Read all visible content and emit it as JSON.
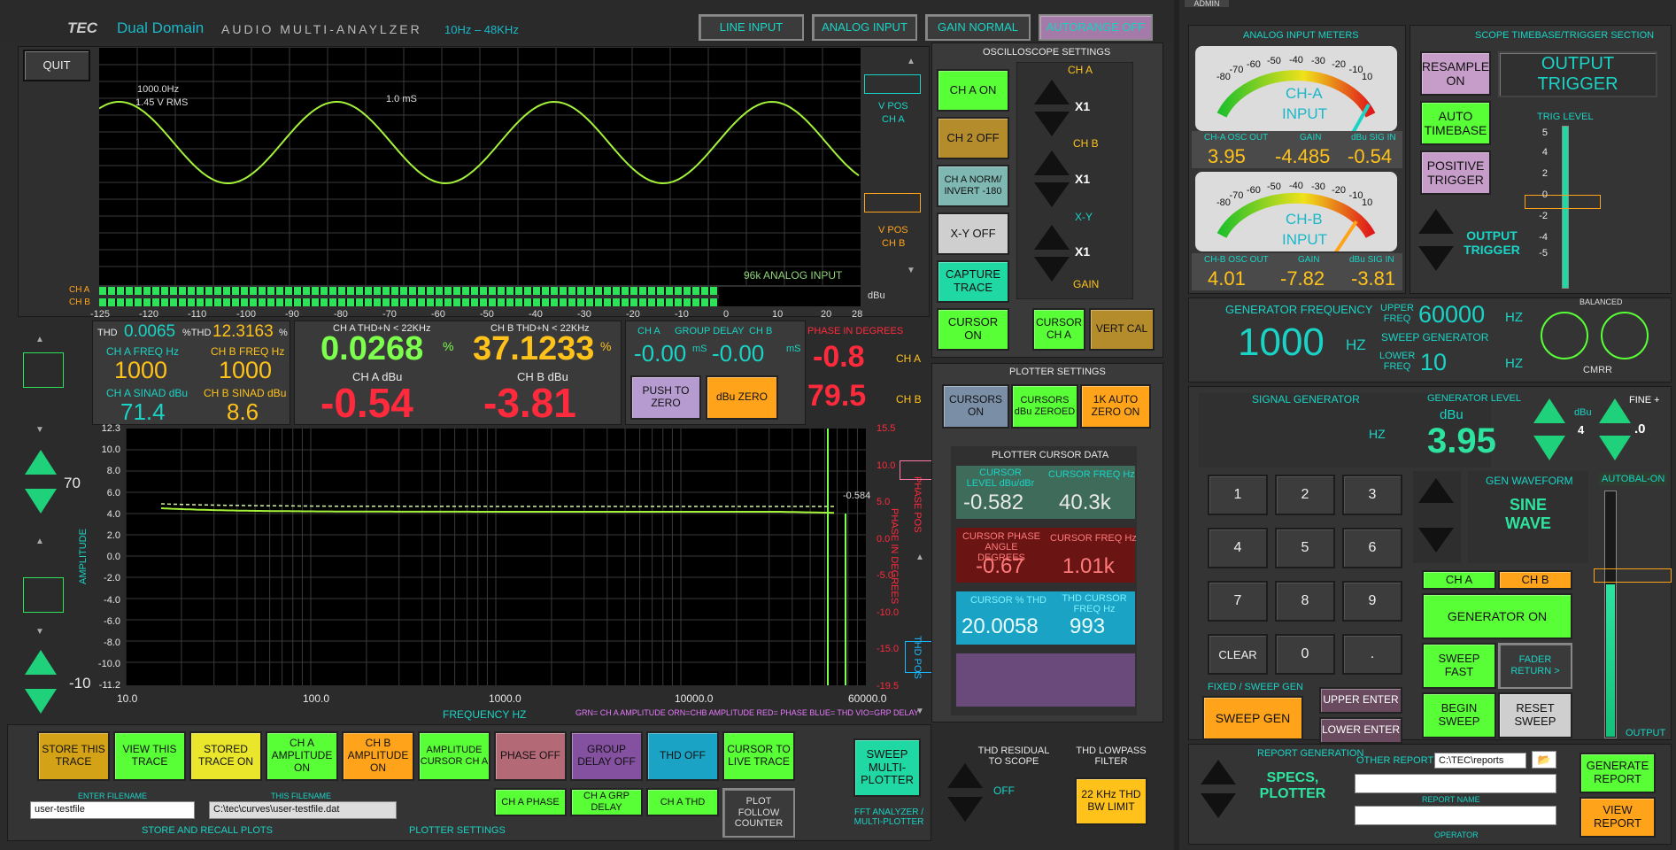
{
  "header": {
    "brand": "TEC",
    "subtitle": "Dual Domain",
    "title": "AUDIO MULTI-ANAYLZER",
    "range": "10Hz – 48KHz",
    "line_input": "LINE INPUT",
    "analog_input": "ANALOG INPUT",
    "gain_normal": "GAIN NORMAL",
    "autorange_off": "AUTORANGE OFF",
    "tab_admin": "ADMIN"
  },
  "quit": "QUIT",
  "scope": {
    "marker1": "1000.0Hz",
    "marker1b": "1.45 V RMS",
    "marker2": "1.0 mS",
    "status": "96k  ANALOG INPUT",
    "vpos_a": "V POS",
    "vpos_a2": "CH A",
    "vpos_b": "V POS",
    "vpos_b2": "CH B",
    "cha": "CH A",
    "chb": "CH B",
    "dbu": "dBu",
    "scale": [
      "-125",
      "-120",
      "-110",
      "-100",
      "-90",
      "-80",
      "-70",
      "-60",
      "-50",
      "-40",
      "-30",
      "-20",
      "-10",
      "0",
      "10",
      "20",
      "28"
    ]
  },
  "readouts": {
    "thd_lbl": "THD",
    "thd_a": "0.0065",
    "pct_thd": "%THD",
    "thd_b": "12.3163",
    "pct": "%",
    "cha_freq_lbl": "CH A FREQ  Hz",
    "chb_freq_lbl": "CH B FREQ  Hz",
    "cha_freq": "1000",
    "chb_freq": "1000",
    "cha_sinad_lbl": "CH A SINAD dBu",
    "chb_sinad_lbl": "CH B SINAD dBu",
    "cha_sinad": "71.4",
    "chb_sinad": "8.6",
    "cha_thdn_lbl": "CH A THD+N  < 22KHz",
    "chb_thdn_lbl": "CH B THD+N  < 22KHz",
    "cha_thdn": "0.0268",
    "chb_thdn": "37.1233",
    "pct1": "%",
    "pct2": "%",
    "cha_dbu_lbl": "CH A dBu",
    "chb_dbu_lbl": "CH B dBu",
    "cha_dbu": "-0.54",
    "chb_dbu": "-3.81",
    "gd_cha": "CH A",
    "gd_lbl": "GROUP DELAY",
    "gd_chb": "CH B",
    "gd_a": "-0.00",
    "gd_b": "-0.00",
    "ms1": "mS",
    "ms2": "mS",
    "push_zero": "PUSH TO ZERO",
    "dbu_zero": "dBu ZERO",
    "phase_lbl": "PHASE IN DEGREES",
    "phase_a": "-0.8",
    "phase_b": "79.5",
    "ph_cha": "CH A",
    "ph_chb": "CH B"
  },
  "left": {
    "val1": "70",
    "val2": "-10"
  },
  "plot": {
    "xlabel": "FREQUENCY HZ",
    "ylabel": "AMPLITUDE",
    "y2label": "PHASE IN DEGREES",
    "phase_pos": "PHASE POS",
    "thd_pos": "THD POS",
    "cursor_val": "-0.584",
    "yticks": [
      "12.3",
      "10.0",
      "8.0",
      "6.0",
      "4.0",
      "2.0",
      "0.0",
      "-2.0",
      "-4.0",
      "-6.0",
      "-8.0",
      "-10.0",
      "-11.2"
    ],
    "y2ticks": [
      "15.5",
      "10.0",
      "5.0",
      "0.0",
      "-5.0",
      "-10.0",
      "-15.0",
      "-19.5"
    ],
    "xticks": [
      "10.0",
      "100.0",
      "1000.0",
      "10000.0",
      "60000.0"
    ],
    "legend": "GRN= CH A AMPLITUDE   ORN=CHB AMPLITUDE   RED= PHASE   BLUE= THD   VIO=GRP DELAY"
  },
  "bottom": {
    "store": "STORE THIS TRACE",
    "view": "VIEW THIS TRACE",
    "stored": "STORED TRACE ON",
    "cha_amp": "CH A AMPLITUDE ON",
    "chb_amp": "CH B AMPLITUDE ON",
    "amp_cursor": "AMPLITUDE CURSOR CH A",
    "phase_off": "PHASE OFF",
    "grp_off": "GROUP DELAY OFF",
    "thd_off": "THD OFF",
    "cursor_live": "CURSOR TO LIVE TRACE",
    "cha_phase": "CH A PHASE",
    "cha_grp": "CH A GRP DELAY",
    "cha_thd": "CH A THD",
    "plot_follow": "PLOT FOLLOW COUNTER",
    "enter_fn": "ENTER FILENAME",
    "this_fn": "THIS FILENAME",
    "filename": "user-testfile",
    "filepath": "C:\\tec\\curves\\user-testfile.dat",
    "store_recall": "STORE AND RECALL PLOTS",
    "plotter_settings": "PLOTTER SETTINGS",
    "sweep_multi": "SWEEP MULTI-PLOTTER",
    "fft": "FFT ANALYZER / MULTI-PLOTTER"
  },
  "osc": {
    "title": "OSCILLOSCOPE SETTINGS",
    "cha_on": "CH A ON",
    "ch2_off": "CH 2 OFF",
    "cha_norm": "CH A NORM/ INVERT -180",
    "xy_off": "X-Y OFF",
    "capture": "CAPTURE TRACE",
    "cursor_on": "CURSOR ON",
    "cursor_cha": "CURSOR CH A",
    "vert_cal": "VERT CAL",
    "cha": "CH A",
    "chb": "CH B",
    "xy": "X-Y",
    "gain": "GAIN",
    "x1a": "X1",
    "x1b": "X1",
    "x1c": "X1"
  },
  "plotter": {
    "title": "PLOTTER SETTINGS",
    "cursors_on": "CURSORS ON",
    "cursors_zeroed": "CURSORS dBu ZEROED",
    "auto_zero": "1K AUTO ZERO ON",
    "cursor_data": "PLOTTER CURSOR DATA",
    "cur_level_lbl": "CURSOR LEVEL dBu/dBr",
    "cur_freq_lbl": "CURSOR FREQ  Hz",
    "cur_level": "-0.582",
    "cur_freq": "40.3k",
    "cur_phase_lbl": "CURSOR PHASE ANGLE DEGREES",
    "cur_freq2_lbl": "CURSOR FREQ  Hz",
    "cur_phase": "-0.67",
    "cur_freq2": "1.01k",
    "cur_thd_lbl": "CURSOR % THD",
    "thd_freq_lbl": "THD CURSOR FREQ  Hz",
    "cur_thd": "20.0058",
    "thd_freq": "993",
    "thd_residual": "THD RESIDUAL TO SCOPE",
    "off": "OFF",
    "thd_lowpass": "THD LOWPASS FILTER",
    "bw_limit": "22 KHz THD BW LIMIT"
  },
  "meters": {
    "title": "ANALOG INPUT METERS",
    "cha": "CH-A",
    "input": "INPUT",
    "chb": "CH-B",
    "input2": "INPUT",
    "scale": [
      "-80",
      "-70",
      "-60",
      "-50",
      "-40",
      "-30",
      "-20",
      "-10",
      "10"
    ],
    "cha_osc_lbl": "CH-A  OSC OUT",
    "gain_lbl": "GAIN",
    "dbu_sig_lbl": "dBu SIG IN",
    "cha_osc": "3.95",
    "cha_gain": "-4.485",
    "cha_sig": "-0.54",
    "chb_osc_lbl": "CH-B OSC  OUT",
    "gain2_lbl": "GAIN",
    "dbu_sig2_lbl": "dBu SIG  IN",
    "chb_osc": "4.01",
    "chb_gain": "-7.82",
    "chb_sig": "-3.81"
  },
  "timebase": {
    "title": "SCOPE TIMEBASE/TRIGGER SECTION",
    "resample": "RESAMPLE ON",
    "auto_tb": "AUTO TIMEBASE",
    "pos_trig": "POSITIVE TRIGGER",
    "output_trig": "OUTPUT TRIGGER",
    "output_trig2": "OUTPUT TRIGGER",
    "trig_level": "TRIG LEVEL",
    "ticks": [
      "5",
      "4",
      "2",
      "0",
      "-2",
      "-4",
      "-5"
    ]
  },
  "genfreq": {
    "title": "GENERATOR FREQUENCY",
    "freq": "1000",
    "hz": "HZ",
    "upper_lbl": "UPPER FREQ",
    "upper": "60000",
    "hz2": "HZ",
    "sweep_gen": "SWEEP GENERATOR",
    "lower_lbl": "LOWER FREQ",
    "lower": "10",
    "hz3": "HZ",
    "balanced": "BALANCED",
    "cmrr": "CMRR"
  },
  "siggen": {
    "title": "SIGNAL GENERATOR",
    "level_lbl": "GENERATOR  LEVEL",
    "dbu": "dBu",
    "hz": "HZ",
    "level": "3.95",
    "fine": "FINE +",
    "dbu2": "dBu",
    "step": "4",
    "step2": ".0",
    "waveform_lbl": "GEN WAVEFORM",
    "waveform": "SINE WAVE",
    "autobal": "AUTOBAL-ON",
    "output": "OUTPUT",
    "keys": [
      "1",
      "2",
      "3",
      "4",
      "5",
      "6",
      "7",
      "8",
      "9",
      "CLEAR",
      "0",
      "."
    ],
    "cha": "CH A",
    "chb": "CH B",
    "gen_on": "GENERATOR ON",
    "sweep_fast": "SWEEP FAST",
    "fader": "FADER RETURN >",
    "begin_sweep": "BEGIN SWEEP",
    "reset_sweep": "RESET SWEEP",
    "fixed_sweep": "FIXED / SWEEP GEN",
    "sweep_gen": "SWEEP GEN",
    "upper_enter": "UPPER ENTER",
    "lower_enter": "LOWER ENTER"
  },
  "report": {
    "title": "REPORT GENERATION",
    "specs": "SPECS, PLOTTER",
    "other": "OTHER REPORTS",
    "path": "C:\\TEC\\reports",
    "report_name": "REPORT NAME",
    "operator": "OPERATOR",
    "generate": "GENERATE REPORT",
    "view": "VIEW REPORT"
  }
}
